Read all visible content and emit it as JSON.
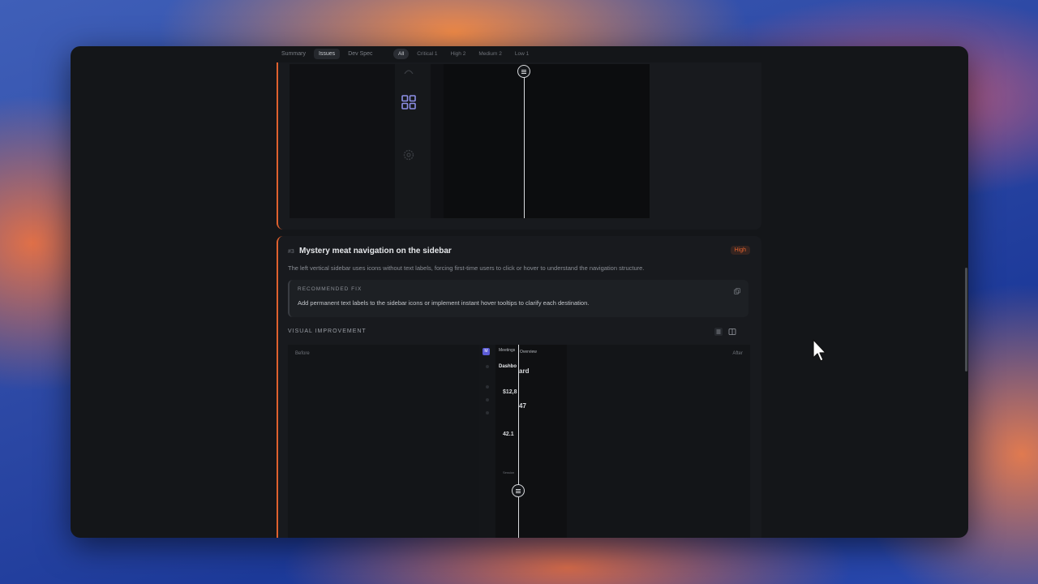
{
  "tabs": [
    {
      "label": "Summary",
      "active": false
    },
    {
      "label": "Issues",
      "active": true
    },
    {
      "label": "Dev Spec",
      "active": false
    }
  ],
  "filters": [
    {
      "label": "All",
      "active": true
    },
    {
      "label": "Critical 1",
      "active": false
    },
    {
      "label": "High 2",
      "active": false
    },
    {
      "label": "Medium 2",
      "active": false
    },
    {
      "label": "Low 1",
      "active": false
    }
  ],
  "issue": {
    "number": "#3",
    "title": "Mystery meat navigation on the sidebar",
    "severity": "High",
    "description": "The left vertical sidebar uses icons without text labels, forcing first-time users to click or hover to understand the navigation structure.",
    "fix_label": "RECOMMENDED FIX",
    "fix_text": "Add permanent text labels to the sidebar icons or implement instant hover tooltips to clarify each destination."
  },
  "visual_improvement": {
    "label": "VISUAL IMPROVEMENT",
    "before_label": "Before",
    "after_label": "After",
    "preview": {
      "logo_letter": "M",
      "menu_item": "Meetings",
      "tab": "Overview",
      "heading_left": "Dashbo",
      "heading_right": "ard",
      "stat1": "$12,8",
      "stat2": "47",
      "stat3": "42.1",
      "footer": "Session"
    }
  },
  "colors": {
    "accent": "#e0612e",
    "window_bg": "#141619",
    "card_bg": "#181a1e"
  },
  "icons": [
    "grid-icon",
    "gear-icon",
    "user-icon",
    "copy-icon",
    "list-view-icon",
    "split-view-icon",
    "cursor-icon"
  ]
}
